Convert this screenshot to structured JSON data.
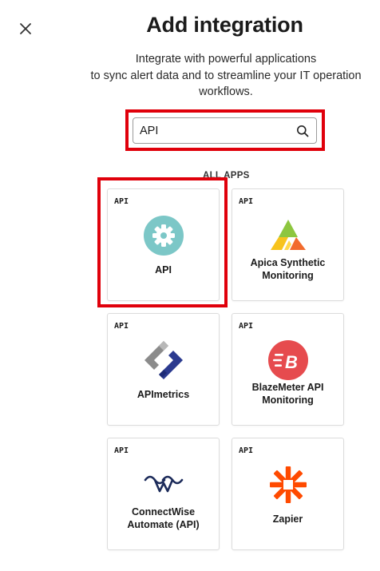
{
  "header": {
    "title": "Add integration",
    "subtitle_lines": [
      "Integrate with powerful applications",
      "to sync alert data and to streamline your IT operation",
      "workflows."
    ]
  },
  "search": {
    "value": "API"
  },
  "section": {
    "label": "ALL APPS"
  },
  "cards": [
    {
      "tag": "API",
      "name": "API",
      "logo": "gear-icon"
    },
    {
      "tag": "API",
      "name": "Apica Synthetic Monitoring",
      "logo": "apica-logo"
    },
    {
      "tag": "API",
      "name": "APImetrics",
      "logo": "apimetrics-logo"
    },
    {
      "tag": "API",
      "name": "BlazeMeter API Monitoring",
      "logo": "blazemeter-logo"
    },
    {
      "tag": "API",
      "name": "ConnectWise Automate (API)",
      "logo": "connectwise-logo"
    },
    {
      "tag": "API",
      "name": "Zapier",
      "logo": "zapier-logo"
    }
  ],
  "colors": {
    "highlight": "#e0000b",
    "api_logo_bg": "#7cc7c7",
    "apimetrics_blue": "#2b3a8f",
    "blazemeter_red": "#e64b4e",
    "connectwise_navy": "#1c2b5a",
    "zapier_orange": "#ff4a00"
  }
}
